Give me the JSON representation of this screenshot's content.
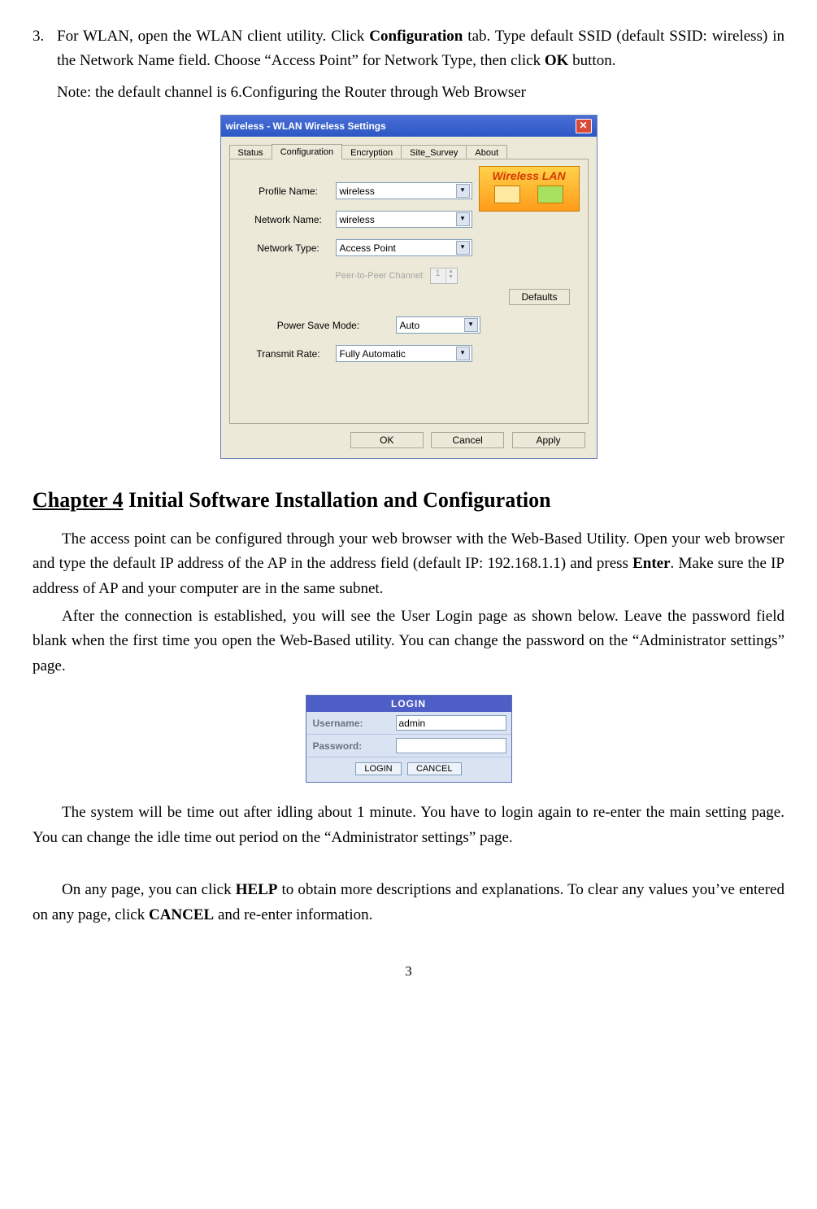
{
  "list": {
    "number": "3.",
    "text_parts": {
      "p1": "For WLAN, open the WLAN client utility. Click ",
      "b1": "Configuration",
      "p2": " tab. Type default SSID (default SSID: wireless) in the Network Name field. Choose “Access Point” for Network Type, then click ",
      "b2": "OK",
      "p3": " button."
    },
    "note": "Note: the default channel is 6.Configuring the Router through Web Browser"
  },
  "wlan": {
    "title": "wireless -  WLAN  Wireless Settings",
    "tabs": [
      "Status",
      "Configuration",
      "Encryption",
      "Site_Survey",
      "About"
    ],
    "active_tab": 1,
    "badge": "Wireless LAN",
    "fields": {
      "profile_label": "Profile Name:",
      "profile_value": "wireless",
      "network_name_label": "Network Name:",
      "network_name_value": "wireless",
      "network_type_label": "Network Type:",
      "network_type_value": "Access Point",
      "peer_label": "Peer-to-Peer Channel:",
      "peer_value": "1",
      "defaults_btn": "Defaults",
      "psm_label": "Power Save Mode:",
      "psm_value": "Auto",
      "txrate_label": "Transmit Rate:",
      "txrate_value": "Fully Automatic"
    },
    "buttons": {
      "ok": "OK",
      "cancel": "Cancel",
      "apply": "Apply"
    }
  },
  "chapter": {
    "num": "Chapter 4",
    "title": " Initial Software Installation and Configuration"
  },
  "para1": {
    "a": "The access point can be configured through your web browser with the Web-Based Utility. Open your web browser and type the default IP address of the AP in the address field (default IP: 192.168.1.1) and press ",
    "b": "Enter",
    "c": ". Make sure the IP address of AP and your computer are in the same subnet."
  },
  "para2": "After the connection is established, you will see the User Login page as shown below. Leave the password field blank when the first time you open the Web-Based utility. You can change the password on the “Administrator settings” page.",
  "login": {
    "header": "LOGIN",
    "username_label": "Username:",
    "username_value": "admin",
    "password_label": "Password:",
    "password_value": "",
    "login_btn": "LOGIN",
    "cancel_btn": "CANCEL"
  },
  "para3": "The system will be time out after idling about 1 minute. You have to login again to re-enter the main setting page. You can change the idle time out period on the “Administrator settings” page.",
  "para4": {
    "a": "On any page, you can click ",
    "b1": "HELP",
    "b": " to obtain more descriptions and explanations. To clear any values you’ve entered on any page, click ",
    "b2": "CANCEL",
    "c": " and re-enter information."
  },
  "page_number": "3"
}
